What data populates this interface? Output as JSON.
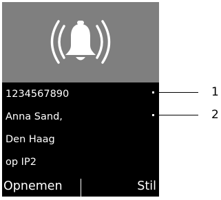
{
  "colors": {
    "header_bg": "#7f7f7f",
    "display_bg": "#000000",
    "text": "#ffffff",
    "bell": "#ffffff"
  },
  "header": {
    "icon": "ringing-bell-icon"
  },
  "display": {
    "lines": [
      "1234567890",
      "Anna Sand,",
      "Den Haag",
      "op  IP2"
    ]
  },
  "softkeys": {
    "left": "Opnemen",
    "right": "Stil"
  },
  "callouts": [
    "1",
    "2"
  ]
}
